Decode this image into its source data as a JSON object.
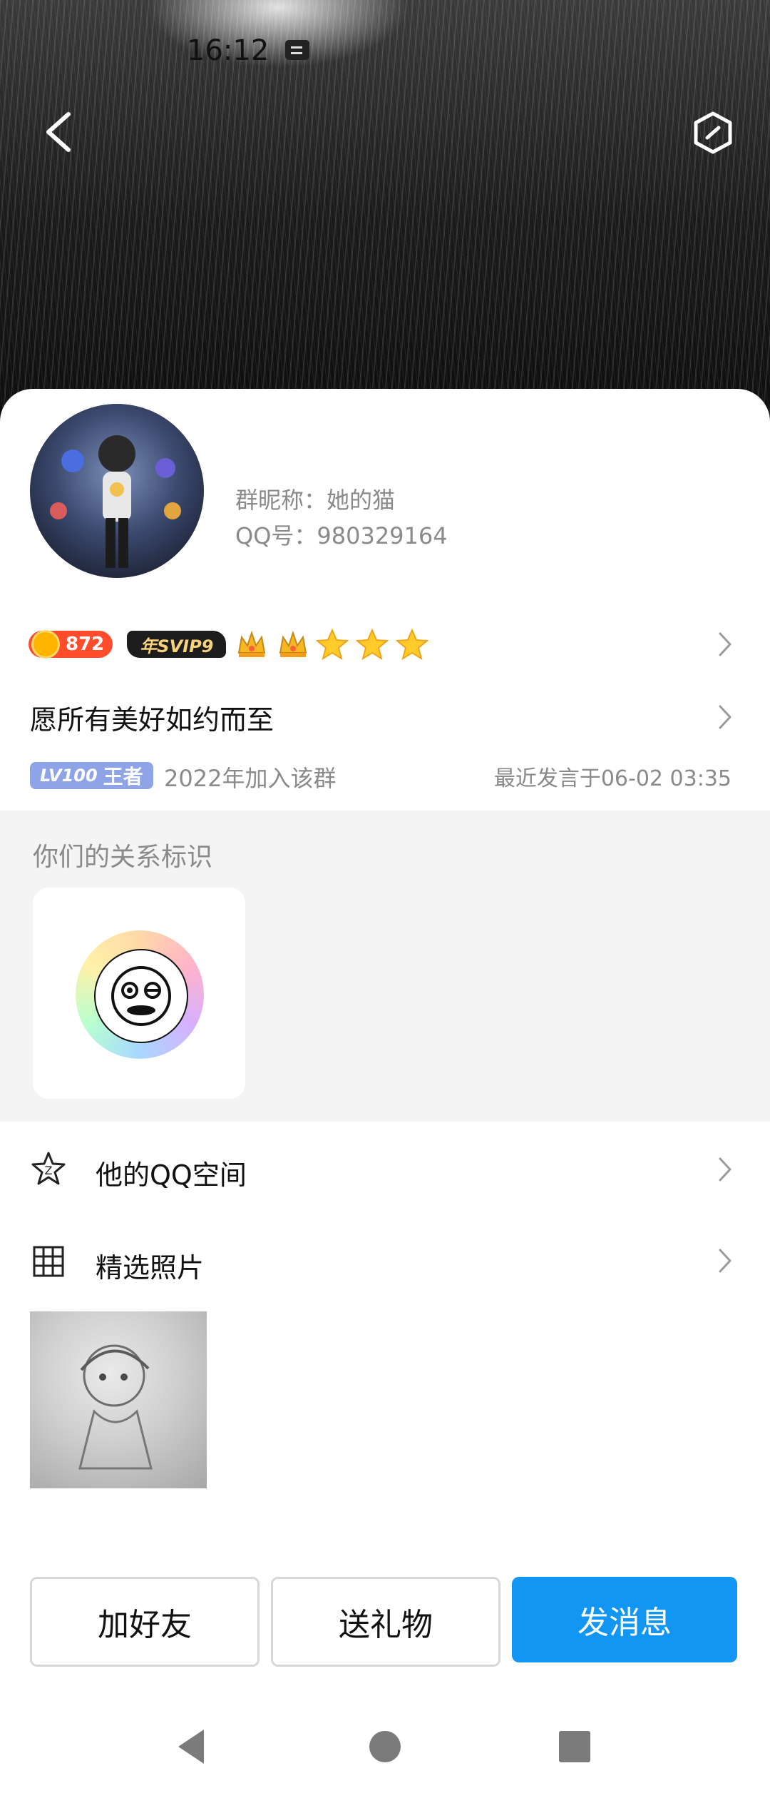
{
  "status": {
    "time": "16:12"
  },
  "header": {
    "back_icon": "chevron-left-icon",
    "settings_icon": "hexagon-icon"
  },
  "profile": {
    "nickname_line": "群昵称：她的猫",
    "qq_line": "QQ号：980329164"
  },
  "badges": {
    "coins": "872",
    "svip": "年SVIP9",
    "crowns": [
      "crown-icon",
      "crown-icon"
    ],
    "stars": [
      "star-icon",
      "star-icon",
      "star-icon"
    ]
  },
  "signature": "愿所有美好如约而至",
  "level": {
    "lv": "LV100",
    "title": "王者"
  },
  "joined": "2022年加入该群",
  "last_message": "最近发言于06-02 03:35",
  "relation": {
    "title": "你们的关系标识"
  },
  "rows": {
    "qzone": {
      "label": "他的QQ空间",
      "icon": "star-outline-icon"
    },
    "photos": {
      "label": "精选照片",
      "icon": "grid-icon"
    }
  },
  "actions": {
    "add_friend": "加好友",
    "send_gift": "送礼物",
    "send_message": "发消息"
  },
  "colors": {
    "primary": "#1296f4",
    "muted": "#8a8a8a",
    "section_bg": "#f4f4f4"
  }
}
